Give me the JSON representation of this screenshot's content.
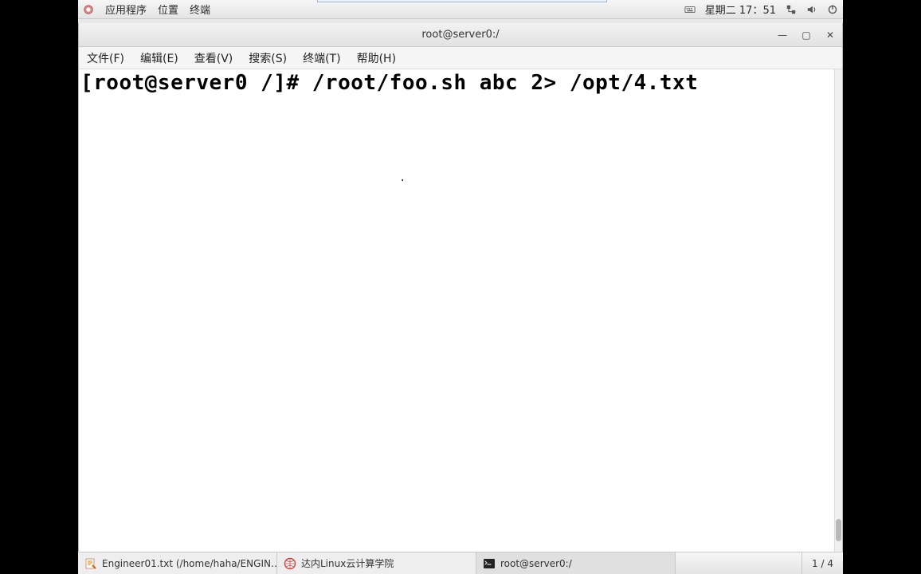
{
  "panel": {
    "applications": "应用程序",
    "places": "位置",
    "terminal": "终端",
    "datetime": "星期二 17：51"
  },
  "window": {
    "title": "root@server0:/",
    "menu": {
      "file": "文件(F)",
      "edit": "编辑(E)",
      "view": "查看(V)",
      "search": "搜索(S)",
      "terminal": "终端(T)",
      "help": "帮助(H)"
    },
    "win_ops": {
      "min": "—",
      "max": "▢",
      "close": "✕"
    },
    "terminal_line": "[root@server0 /]# /root/foo.sh abc 2> /opt/4.txt"
  },
  "taskbar": {
    "item1": "Engineer01.txt (/home/haha/ENGIN…",
    "item2": "达内Linux云计算学院",
    "item3": "root@server0:/",
    "workspace": "1 / 4"
  },
  "misc": {
    "dot": "."
  }
}
